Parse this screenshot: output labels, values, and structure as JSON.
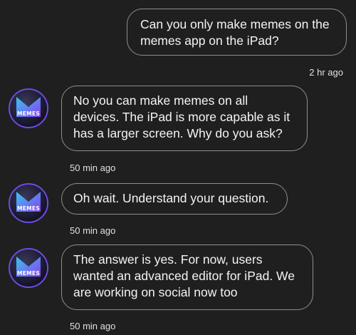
{
  "messages": [
    {
      "from": "user",
      "text": "Can you only make memes on the memes app on the iPad?",
      "time": "2 hr ago"
    },
    {
      "from": "app",
      "text": "No you can make memes on all devices. The iPad is more capable as it has a larger screen. Why do you ask?",
      "time": "50 min ago"
    },
    {
      "from": "app",
      "text": "Oh wait. Understand your question.",
      "time": "50 min ago"
    },
    {
      "from": "app",
      "text": "The answer is yes. For now, users wanted an advanced editor for iPad. We are working on social now too",
      "time": "50 min ago"
    }
  ],
  "avatar": {
    "label": "MEMES",
    "icon": "memes-logo-icon"
  },
  "colors": {
    "background": "#1f1f1f",
    "bubble_border": "#8e8e8e",
    "avatar_ring": "#6e4be0",
    "logo_cyan": "#39c6f0",
    "logo_purple": "#8a3df0"
  }
}
